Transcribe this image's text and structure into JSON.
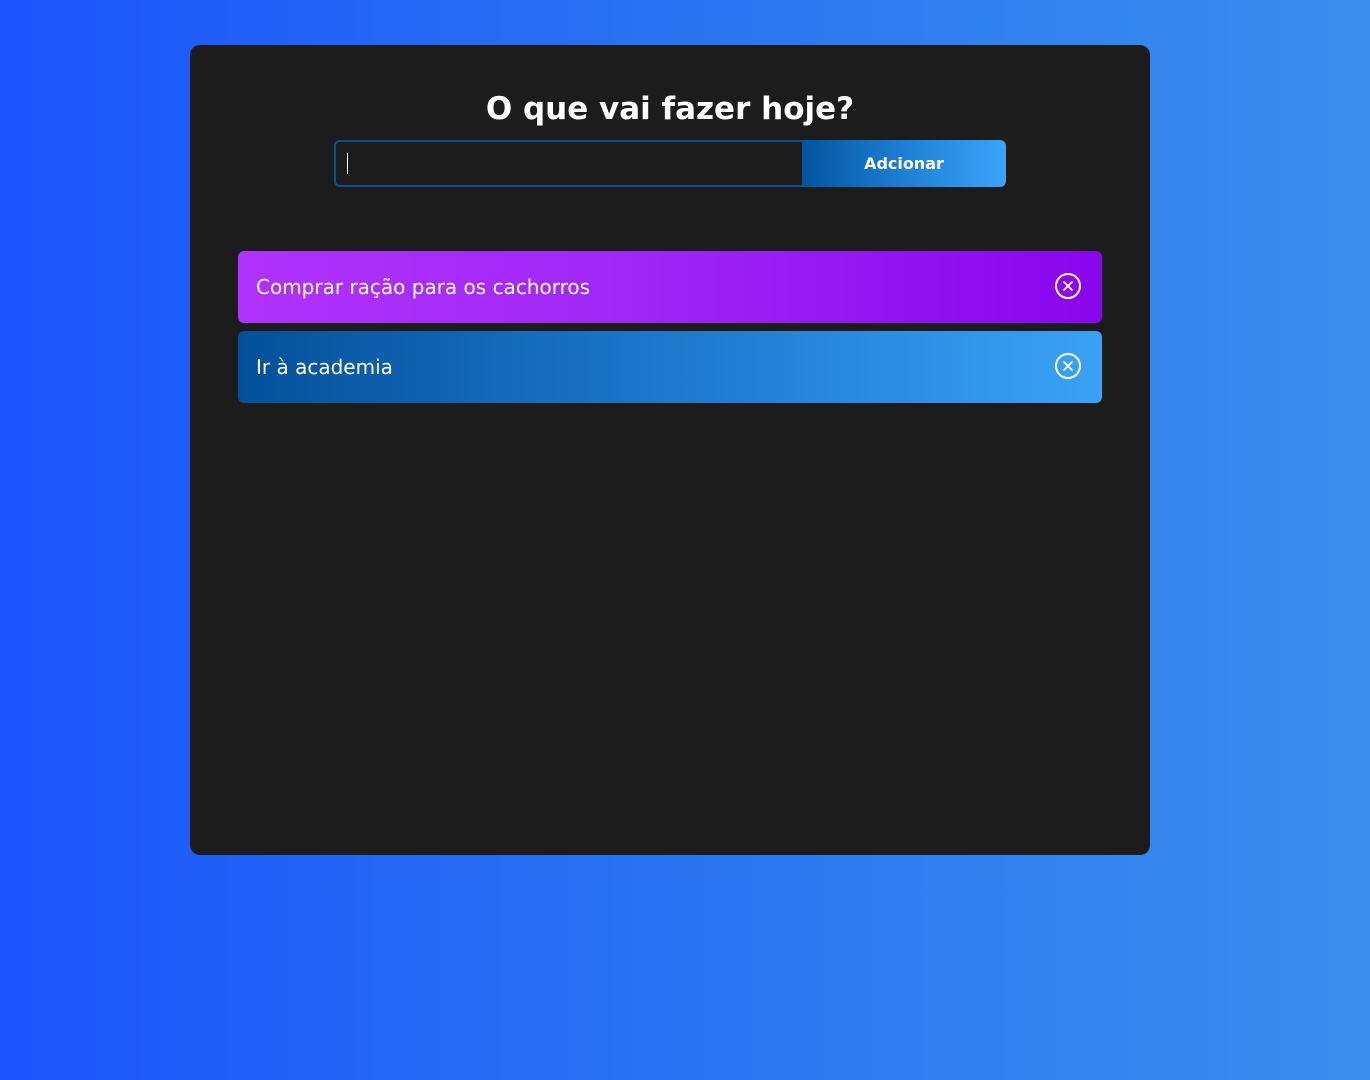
{
  "header": {
    "title": "O que vai fazer hoje?"
  },
  "form": {
    "input_value": "",
    "input_placeholder": "",
    "add_button_label": "Adcionar"
  },
  "todos": [
    {
      "text": "Comprar ração para os cachorros",
      "color": "#a12af8",
      "icon": "close-circle-icon"
    },
    {
      "text": "Ir à academia",
      "color": "#1b74c8",
      "icon": "close-circle-icon"
    }
  ],
  "colors": {
    "background_start": "#1c54fb",
    "background_end": "#3a8fee",
    "panel": "#1c1c1c",
    "accent_blue": "#3aa5fb",
    "accent_purple": "#8a05ec"
  }
}
